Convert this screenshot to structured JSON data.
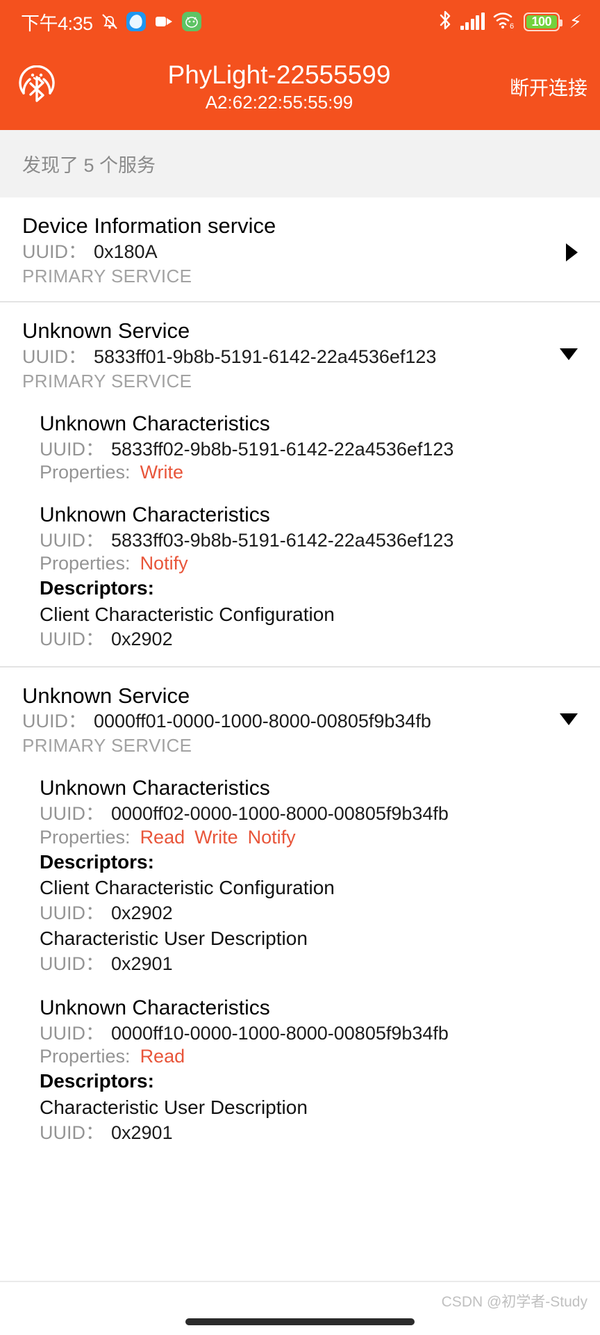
{
  "statusbar": {
    "time": "下午4:35",
    "icons_left": [
      "bell-muted-icon",
      "app-blue-icon",
      "video-camera-icon",
      "app-green-icon"
    ],
    "icons_right": [
      "bluetooth-icon",
      "signal-bars-icon",
      "wifi6-icon"
    ],
    "battery_level": "100",
    "charging": true,
    "wifi_label": "6"
  },
  "header": {
    "logo": "bluetooth-logo-icon",
    "device_name": "PhyLight-22555599",
    "mac_address": "A2:62:22:55:55:99",
    "disconnect_label": "断开连接",
    "accent_color": "#f4511e"
  },
  "discovered": {
    "text": "发现了 5 个服务"
  },
  "labels": {
    "uuid": "UUID：",
    "properties": "Properties:",
    "descriptors": "Descriptors:",
    "primary_service": "PRIMARY SERVICE",
    "property_color": "#e8553a"
  },
  "services": [
    {
      "name": "Device Information service",
      "uuid": "0x180A",
      "type": "PRIMARY SERVICE",
      "expanded": false,
      "arrow": "chevron-right-icon",
      "characteristics": []
    },
    {
      "name": "Unknown Service",
      "uuid": "5833ff01-9b8b-5191-6142-22a4536ef123",
      "type": "PRIMARY SERVICE",
      "expanded": true,
      "arrow": "chevron-down-icon",
      "characteristics": [
        {
          "name": "Unknown Characteristics",
          "uuid": "5833ff02-9b8b-5191-6142-22a4536ef123",
          "properties": [
            "Write"
          ],
          "descriptors": []
        },
        {
          "name": "Unknown Characteristics",
          "uuid": "5833ff03-9b8b-5191-6142-22a4536ef123",
          "properties": [
            "Notify"
          ],
          "descriptors": [
            {
              "name": "Client Characteristic Configuration",
              "uuid": "0x2902"
            }
          ]
        }
      ]
    },
    {
      "name": "Unknown Service",
      "uuid": "0000ff01-0000-1000-8000-00805f9b34fb",
      "type": "PRIMARY SERVICE",
      "expanded": true,
      "arrow": "chevron-down-icon",
      "characteristics": [
        {
          "name": "Unknown Characteristics",
          "uuid": "0000ff02-0000-1000-8000-00805f9b34fb",
          "properties": [
            "Read",
            "Write",
            "Notify"
          ],
          "descriptors": [
            {
              "name": "Client Characteristic Configuration",
              "uuid": "0x2902"
            },
            {
              "name": "Characteristic User Description",
              "uuid": "0x2901"
            }
          ]
        },
        {
          "name": "Unknown Characteristics",
          "uuid": "0000ff10-0000-1000-8000-00805f9b34fb",
          "properties": [
            "Read"
          ],
          "descriptors": [
            {
              "name": "Characteristic User Description",
              "uuid": "0x2901"
            }
          ]
        }
      ]
    }
  ],
  "footer": {
    "watermark": "CSDN @初学者-Study"
  }
}
